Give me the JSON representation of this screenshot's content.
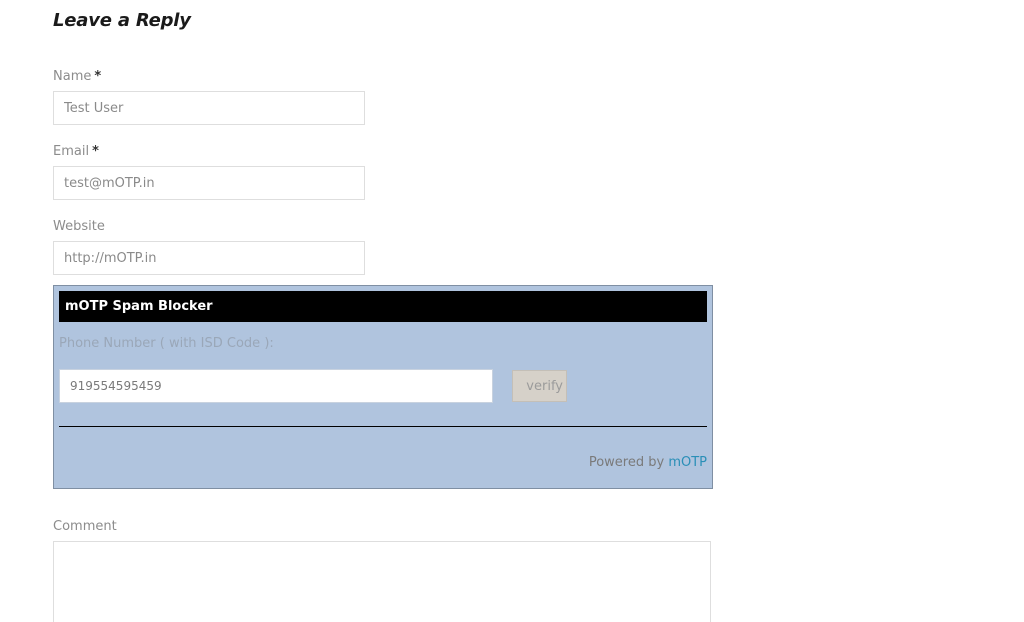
{
  "reply": {
    "title": "Leave a Reply"
  },
  "form": {
    "name": {
      "label": "Name",
      "required_mark": "*",
      "value": "Test User"
    },
    "email": {
      "label": "Email",
      "required_mark": "*",
      "value": "test@mOTP.in"
    },
    "website": {
      "label": "Website",
      "value": "http://mOTP.in"
    },
    "comment": {
      "label": "Comment",
      "value": ""
    }
  },
  "spam_blocker": {
    "title": "mOTP Spam Blocker",
    "phone_label": "Phone Number ( with ISD Code ):",
    "phone_value": "919554595459",
    "verify_label": "verify",
    "powered_by_text": "Powered by",
    "powered_by_link": "mOTP",
    "colors": {
      "box_background": "#b0c4de",
      "header_background": "#000000",
      "link": "#2a8fb7"
    }
  }
}
